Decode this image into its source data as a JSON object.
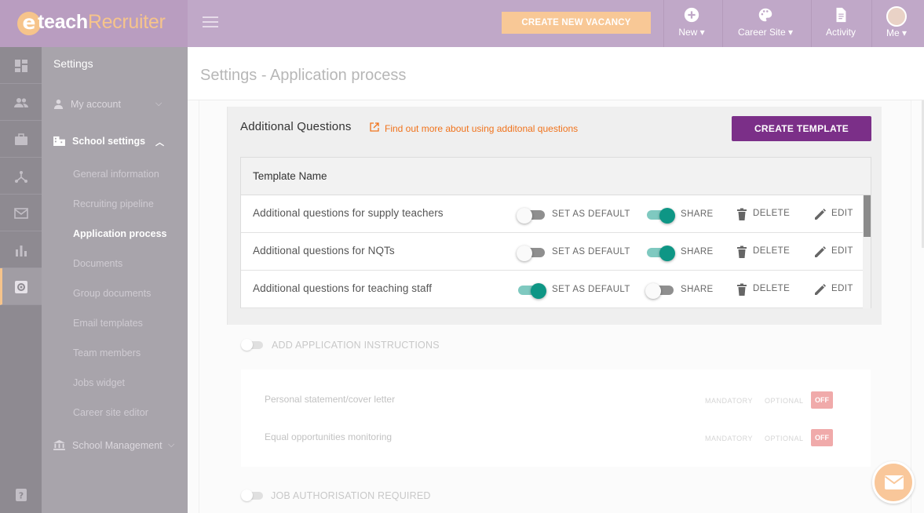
{
  "brand": {
    "mark": "e",
    "word_primary": "teach",
    "word_secondary": "Recruiter"
  },
  "topbar": {
    "create_vacancy": "CREATE NEW VACANCY",
    "nav": [
      {
        "label": "New ▾",
        "icon": "plus-circle-icon"
      },
      {
        "label": "Career Site ▾",
        "icon": "palette-icon"
      },
      {
        "label": "Activity",
        "icon": "document-icon"
      },
      {
        "label": "Me ▾",
        "icon": "avatar"
      }
    ]
  },
  "sidebar": {
    "title": "Settings",
    "my_account": "My account",
    "school_settings": "School settings",
    "items": [
      "General information",
      "Recruiting pipeline",
      "Application process",
      "Documents",
      "Group documents",
      "Email templates",
      "Team members",
      "Jobs widget",
      "Career site editor"
    ],
    "school_management": "School Management"
  },
  "page": {
    "title": "Settings - Application process"
  },
  "additional_questions": {
    "title": "Additional Questions",
    "link": "Find out more about using additonal questions",
    "create_button": "CREATE TEMPLATE",
    "column_header": "Template Name",
    "labels": {
      "set_default": "SET AS DEFAULT",
      "share": "SHARE",
      "delete": "DELETE",
      "edit": "EDIT"
    },
    "templates": [
      {
        "name": "Additional questions for supply teachers",
        "is_default": false,
        "shared": true
      },
      {
        "name": "Additional questions for NQTs",
        "is_default": false,
        "shared": true
      },
      {
        "name": "Additional questions for teaching staff",
        "is_default": true,
        "shared": false
      }
    ]
  },
  "application_instructions": {
    "toggle_label": "ADD APPLICATION INSTRUCTIONS",
    "rows": [
      {
        "label": "Personal statement/cover letter",
        "mandatory": "MANDATORY",
        "optional": "OPTIONAL",
        "state": "OFF"
      },
      {
        "label": "Equal opportunities monitoring",
        "mandatory": "MANDATORY",
        "optional": "OPTIONAL",
        "state": "OFF"
      }
    ]
  },
  "job_authorisation": {
    "toggle_label": "JOB AUTHORISATION REQUIRED"
  },
  "colors": {
    "accent_purple": "#7b2f88",
    "link_orange": "#f0731c",
    "toggle_teal": "#0e9685",
    "topbar": "#c0a8c8"
  }
}
